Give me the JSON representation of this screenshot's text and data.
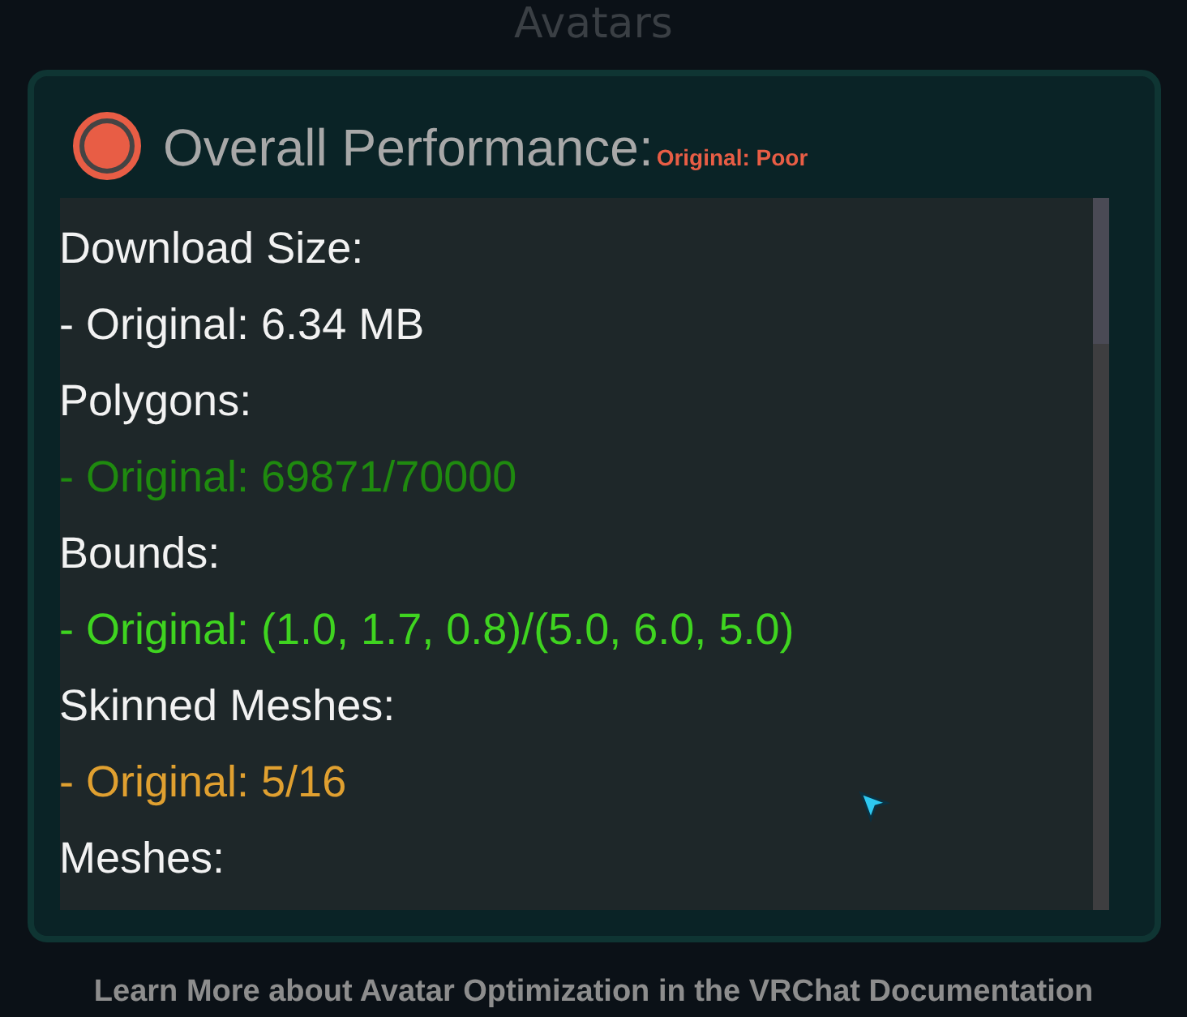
{
  "page_title": "Avatars",
  "dialog": {
    "title": "Overall Performance:",
    "rating": "Original: Poor",
    "metrics": [
      {
        "label": "Download Size:",
        "value": "- Original: 6.34 MB",
        "color": "#f2f2f2"
      },
      {
        "label": "Polygons:",
        "value": "- Original: 69871/70000",
        "color": "#1f8a0f"
      },
      {
        "label": "Bounds:",
        "value": "- Original: (1.0, 1.7, 0.8)/(5.0, 6.0, 5.0)",
        "color": "#3fd420"
      },
      {
        "label": "Skinned Meshes:",
        "value": "- Original: 5/16",
        "color": "#e0a030"
      },
      {
        "label": "Meshes:"
      }
    ]
  },
  "footer_link": "Learn More about Avatar Optimization in the VRChat Documentation"
}
